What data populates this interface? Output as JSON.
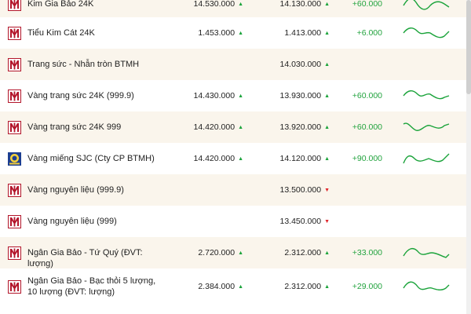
{
  "colors": {
    "brand": "#b3162b",
    "up": "#1aa33a",
    "down": "#e0262b",
    "row_alt": "#faf5ec"
  },
  "rows": [
    {
      "name": "Kim Gia Bảo 24K",
      "buy": "14.530.000",
      "buy_dir": "up",
      "sell": "14.130.000",
      "sell_dir": "up",
      "change": "+60.000",
      "logo": "btmh-logo-icon",
      "spark": true
    },
    {
      "name": "Tiểu Kim Cát 24K",
      "buy": "1.453.000",
      "buy_dir": "up",
      "sell": "1.413.000",
      "sell_dir": "up",
      "change": "+6.000",
      "logo": "btmh-logo-icon",
      "spark": true
    },
    {
      "name": "Trang sức - Nhẫn tròn BTMH",
      "buy": "",
      "buy_dir": "",
      "sell": "14.030.000",
      "sell_dir": "up",
      "change": "",
      "logo": "btmh-logo-icon",
      "spark": false
    },
    {
      "name": "Vàng trang sức 24K (999.9)",
      "buy": "14.430.000",
      "buy_dir": "up",
      "sell": "13.930.000",
      "sell_dir": "up",
      "change": "+60.000",
      "logo": "btmh-logo-icon",
      "spark": true
    },
    {
      "name": "Vàng trang sức 24K 999",
      "buy": "14.420.000",
      "buy_dir": "up",
      "sell": "13.920.000",
      "sell_dir": "up",
      "change": "+60.000",
      "logo": "btmh-logo-icon",
      "spark": true
    },
    {
      "name": "Vàng miếng SJC (Cty CP BTMH)",
      "buy": "14.420.000",
      "buy_dir": "up",
      "sell": "14.120.000",
      "sell_dir": "up",
      "change": "+90.000",
      "logo": "sjc-logo-icon",
      "spark": true
    },
    {
      "name": "Vàng nguyên liệu (999.9)",
      "buy": "",
      "buy_dir": "",
      "sell": "13.500.000",
      "sell_dir": "down",
      "change": "",
      "logo": "btmh-logo-icon",
      "spark": false
    },
    {
      "name": "Vàng nguyên liệu (999)",
      "buy": "",
      "buy_dir": "",
      "sell": "13.450.000",
      "sell_dir": "down",
      "change": "",
      "logo": "btmh-logo-icon",
      "spark": false
    },
    {
      "name": "Ngân Gia Bảo - Tứ Quý (ĐVT: lượng)",
      "buy": "2.720.000",
      "buy_dir": "up",
      "sell": "2.312.000",
      "sell_dir": "up",
      "change": "+33.000",
      "logo": "btmh-logo-icon",
      "spark": true
    },
    {
      "name": "Ngân Gia Bảo - Bạc thỏi 5 lượng, 10 lượng (ĐVT: lượng)",
      "buy": "2.384.000",
      "buy_dir": "up",
      "sell": "2.312.000",
      "sell_dir": "up",
      "change": "+29.000",
      "logo": "btmh-logo-icon",
      "spark": true
    }
  ]
}
